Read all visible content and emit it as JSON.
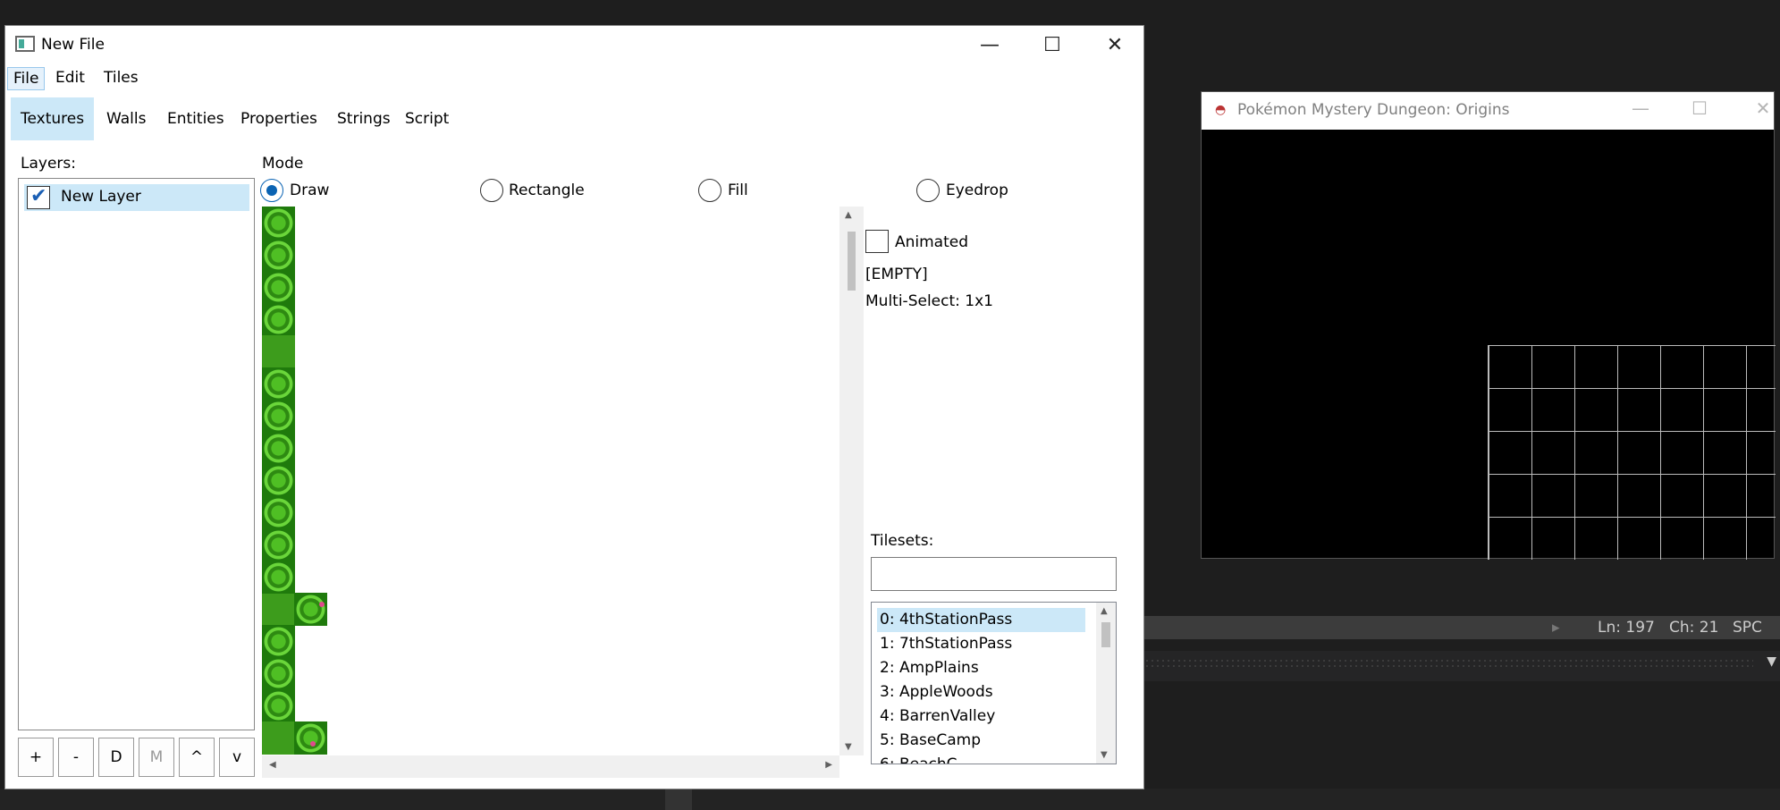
{
  "editor": {
    "title": "New File",
    "controls": {
      "minimize": "—",
      "maximize": "☐",
      "close": "✕"
    },
    "menu": [
      {
        "label": "File"
      },
      {
        "label": "Edit"
      },
      {
        "label": "Tiles"
      }
    ],
    "tabs": [
      "Textures",
      "Walls",
      "Entities",
      "Properties",
      "Strings",
      "Script"
    ],
    "layers": {
      "label": "Layers:",
      "items": [
        {
          "name": "New Layer",
          "checked": true
        }
      ],
      "buttons": [
        "+",
        "-",
        "D",
        "M",
        "^",
        "v"
      ]
    },
    "mode": {
      "label": "Mode",
      "options": [
        "Draw",
        "Rectangle",
        "Fill",
        "Eyedrop"
      ],
      "selected": "Draw"
    },
    "tile_info": {
      "animated_label": "Animated",
      "empty_label": "[EMPTY]",
      "multiselect": "Multi-Select: 1x1"
    },
    "tilesets": {
      "label": "Tilesets:",
      "search_value": "",
      "items": [
        "0: 4thStationPass",
        "1: 7thStationPass",
        "2: AmpPlains",
        "3: AppleWoods",
        "4: BarrenValley",
        "5: BaseCamp",
        "6: BeachC..."
      ],
      "selected_index": 0
    }
  },
  "game_window": {
    "title": "Pokémon Mystery Dungeon: Origins",
    "controls": {
      "minimize": "—",
      "maximize": "☐",
      "close": "✕"
    }
  },
  "ide": {
    "status": {
      "line": "Ln: 197",
      "col": "Ch: 21",
      "mode": "SPC"
    }
  },
  "colors": {
    "selection": "#cce8f8",
    "radio_accent": "#0a63b3",
    "grass": "#3d9c1c"
  }
}
